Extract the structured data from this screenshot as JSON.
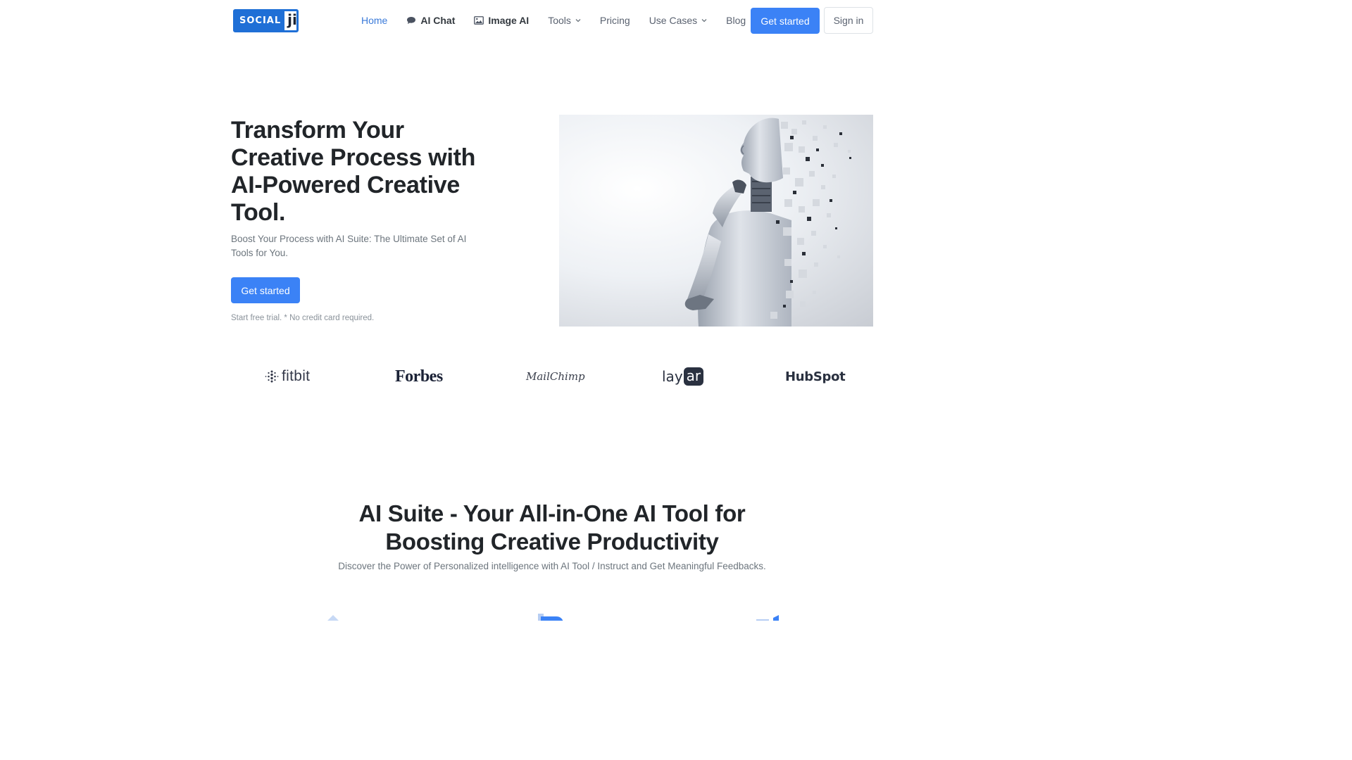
{
  "logo": {
    "part1": "SOCIAL",
    "part2": "ji"
  },
  "nav": {
    "home": "Home",
    "ai_chat": "AI Chat",
    "image_ai": "Image AI",
    "tools": "Tools",
    "pricing": "Pricing",
    "use_cases": "Use Cases",
    "blog": "Blog",
    "get_started": "Get started",
    "sign_in": "Sign in"
  },
  "hero": {
    "title": "Transform Your Creative Process with AI-Powered Creative Tool.",
    "subtitle": "Boost Your Process with AI Suite: The Ultimate Set of AI Tools for You.",
    "cta": "Get started",
    "note": "Start free trial. * No credit card required."
  },
  "brands": {
    "fitbit": "fitbit",
    "forbes": "Forbes",
    "mailchimp": "MailChimp",
    "layar_1": "lay",
    "layar_2": "ar",
    "hubspot": "HubSpot"
  },
  "section2": {
    "title_line1": "AI Suite - Your All-in-One AI Tool for",
    "title_line2": "Boosting Creative Productivity",
    "subtitle": "Discover the Power of Personalized intelligence with AI Tool / Instruct and Get Meaningful Feedbacks."
  },
  "colors": {
    "primary": "#3b82f6",
    "active_link": "#3a7ad9",
    "logo_blue": "#1f6fd6"
  }
}
